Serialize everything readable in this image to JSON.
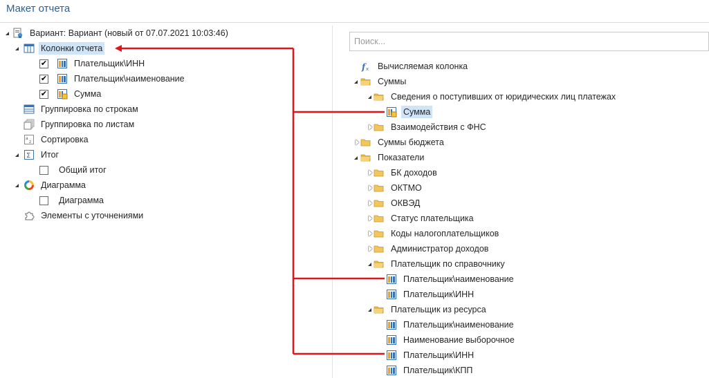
{
  "window": {
    "title": "Макет отчета"
  },
  "left_tree": {
    "root": "Вариант: Вариант (новый от 07.07.2021 10:03:46)",
    "columns": "Колонки отчета",
    "col_items": [
      "Плательщик\\ИНН",
      "Плательщик\\наименование",
      "Сумма"
    ],
    "grouping_rows": "Группировка по строкам",
    "grouping_sheets": "Группировка по листам",
    "sorting": "Сортировка",
    "total": "Итог",
    "total_item": "Общий итог",
    "diagram": "Диаграмма",
    "diagram_item": "Диаграмма",
    "refinements": "Элементы с уточнениями"
  },
  "search": {
    "placeholder": "Поиск..."
  },
  "right_tree": {
    "calc_column": "Вычисляемая колонка",
    "sums": "Суммы",
    "sums_info": "Сведения о поступивших от юридических лиц платежах",
    "sum": "Сумма",
    "fns": "Взаимодействия с ФНС",
    "budget_sums": "Суммы бюджета",
    "indicators": "Показатели",
    "bk": "БК доходов",
    "oktmo": "ОКТМО",
    "okved": "ОКВЭД",
    "payer_status": "Статус плательщика",
    "tax_codes": "Коды налогоплательщиков",
    "admin": "Администратор доходов",
    "payer_ref": "Плательщик по справочнику",
    "payer_ref_name": "Плательщик\\наименование",
    "payer_ref_inn": "Плательщик\\ИНН",
    "payer_res": "Плательщик из ресурса",
    "payer_res_name": "Плательщик\\наименование",
    "payer_res_sel": "Наименование выборочное",
    "payer_res_inn": "Плательщик\\ИНН",
    "payer_res_kpp": "Плательщик\\КПП"
  },
  "colors": {
    "highlight": "#cfe4f7",
    "annotation": "#e0151b",
    "title": "#2e5f8c"
  }
}
